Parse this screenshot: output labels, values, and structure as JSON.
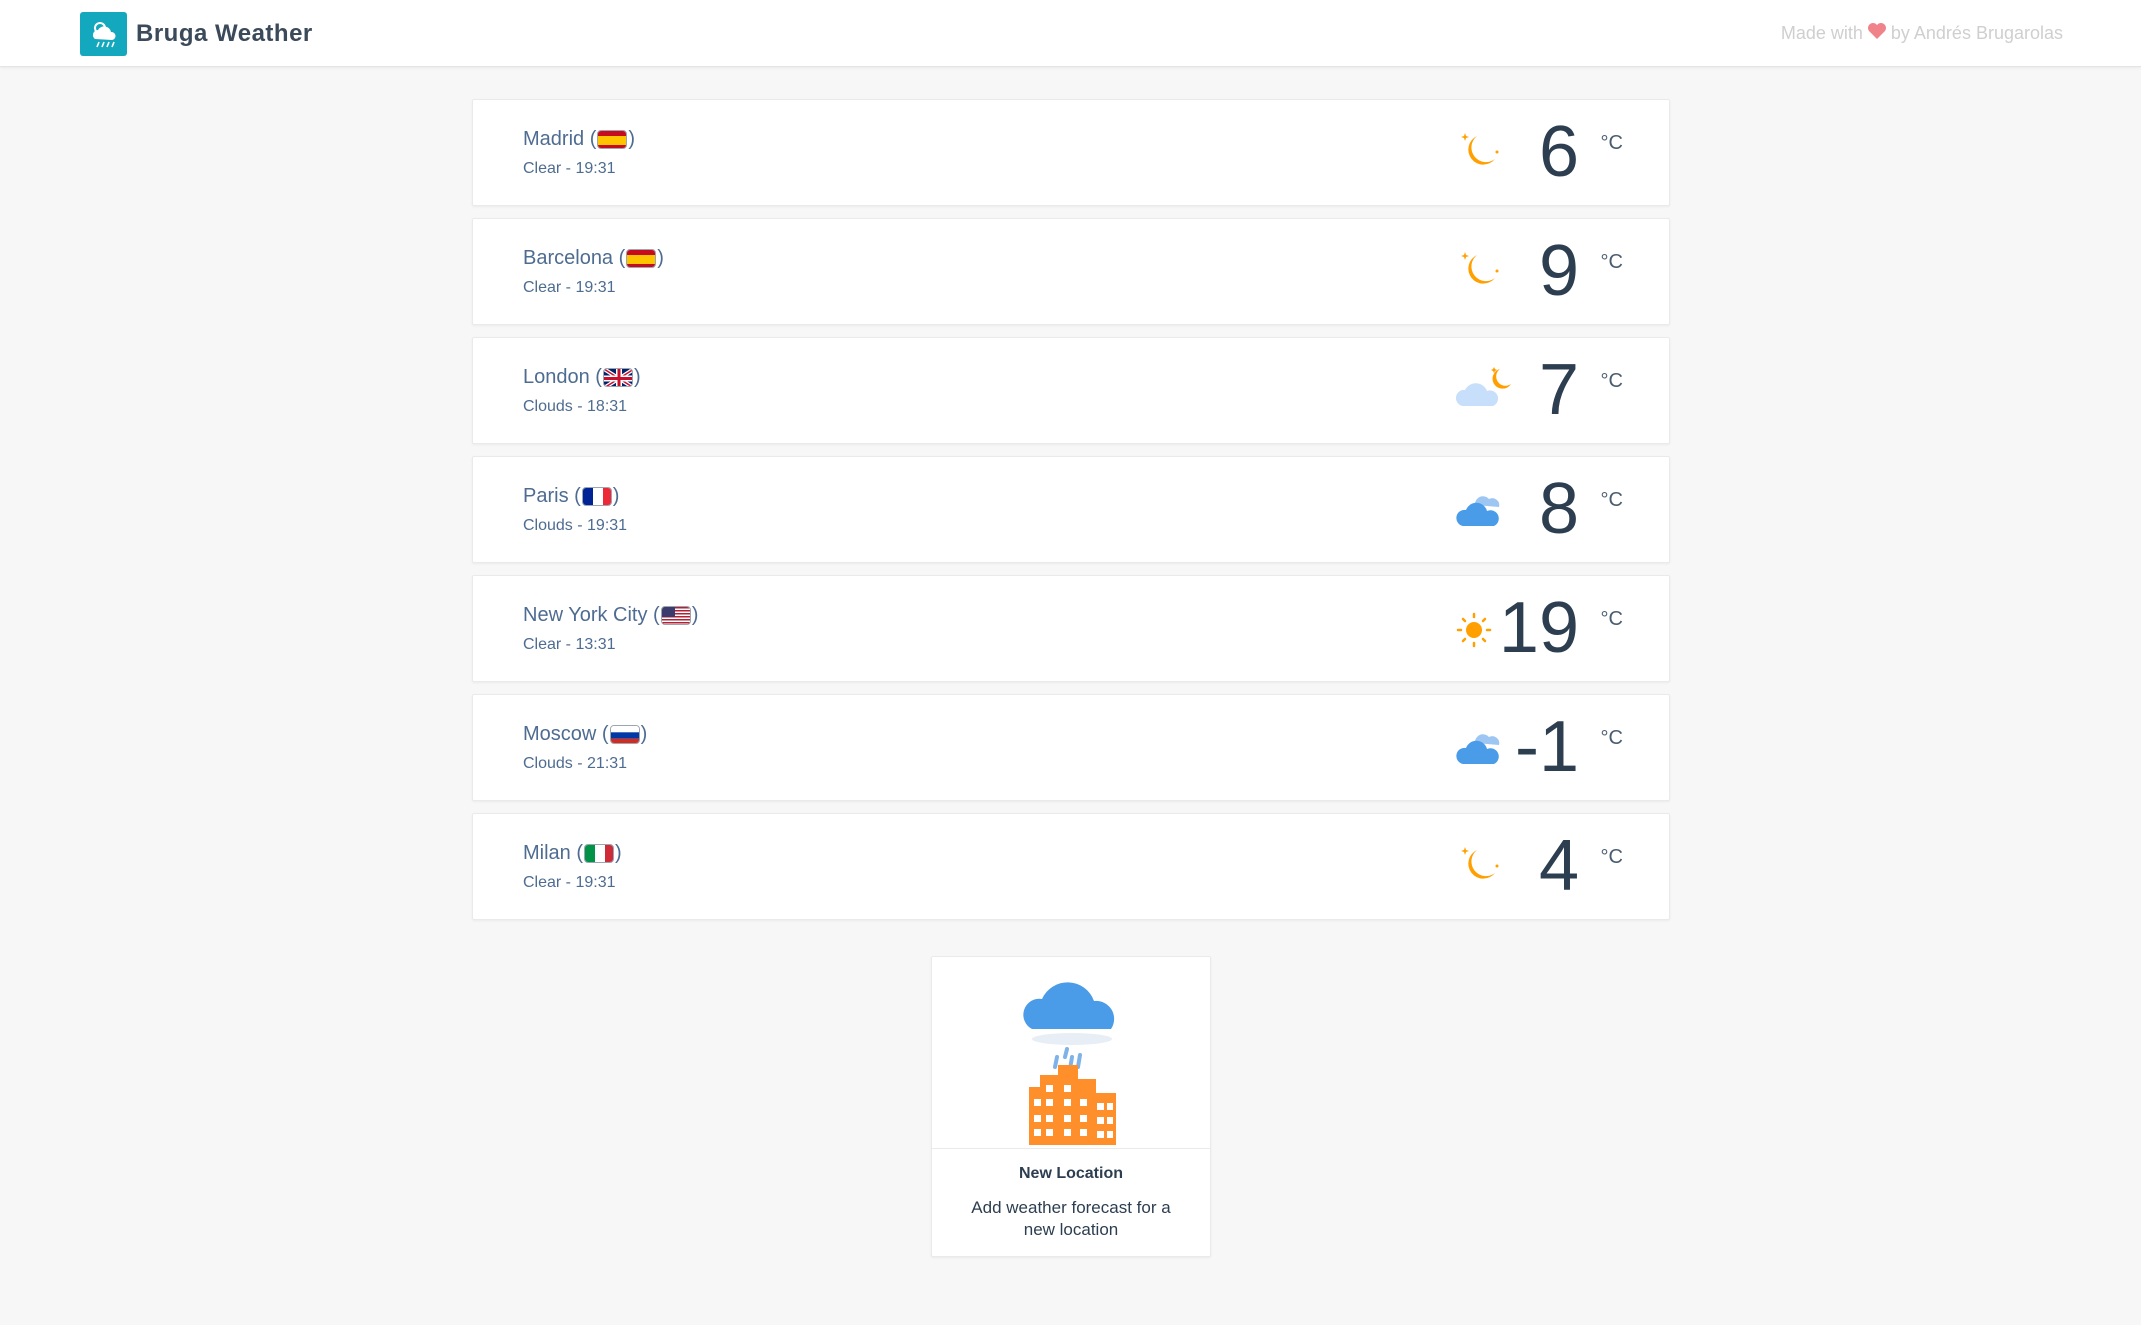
{
  "header": {
    "brand_name": "Bruga Weather",
    "credit_prefix": "Made with",
    "credit_suffix": "by Andrés Brugarolas"
  },
  "locations": [
    {
      "city": "Madrid",
      "flag": "es",
      "status": "Clear - 19:31",
      "icon": "moon-icon",
      "temp": "6",
      "unit": "°C"
    },
    {
      "city": "Barcelona",
      "flag": "es",
      "status": "Clear - 19:31",
      "icon": "moon-icon",
      "temp": "9",
      "unit": "°C"
    },
    {
      "city": "London",
      "flag": "gb",
      "status": "Clouds - 18:31",
      "icon": "cloud-moon-icon",
      "temp": "7",
      "unit": "°C"
    },
    {
      "city": "Paris",
      "flag": "fr",
      "status": "Clouds - 19:31",
      "icon": "cloud-icon",
      "temp": "8",
      "unit": "°C"
    },
    {
      "city": "New York City",
      "flag": "us",
      "status": "Clear - 13:31",
      "icon": "sun-icon",
      "temp": "19",
      "unit": "°C"
    },
    {
      "city": "Moscow",
      "flag": "ru",
      "status": "Clouds - 21:31",
      "icon": "cloud-icon",
      "temp": "-1",
      "unit": "°C"
    },
    {
      "city": "Milan",
      "flag": "it",
      "status": "Clear - 19:31",
      "icon": "moon-icon",
      "temp": "4",
      "unit": "°C"
    }
  ],
  "new_location": {
    "title": "New Location",
    "description": "Add weather forecast for a new location"
  },
  "colors": {
    "brand": "#13a8bd",
    "moon": "#ffa000",
    "cloud": "#4a9be8",
    "building": "#ff8f2b",
    "heart": "#f0828a"
  }
}
